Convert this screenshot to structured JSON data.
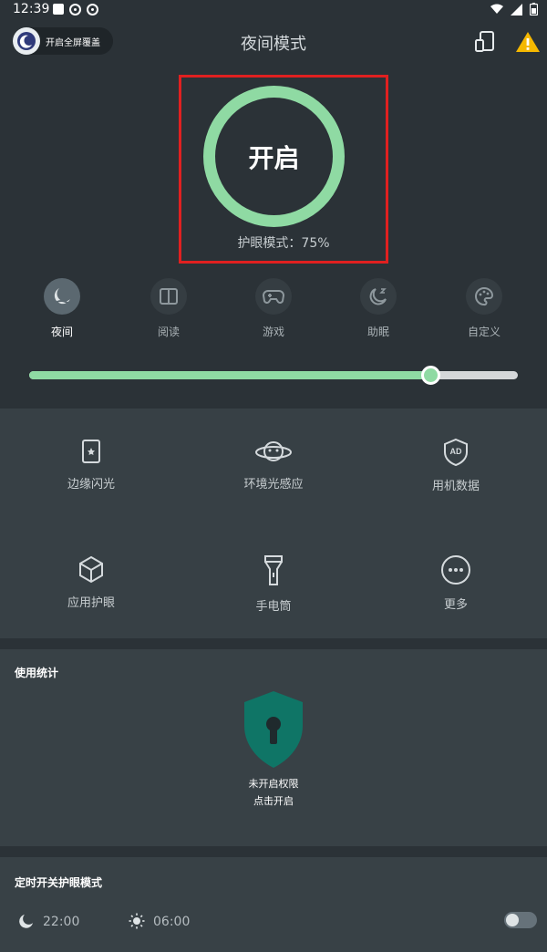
{
  "status_bar": {
    "time": "12:39"
  },
  "header": {
    "overlay_label": "开启全屏覆盖",
    "title": "夜间模式"
  },
  "toggle": {
    "label": "开启",
    "mode_status": "护眼模式：75%",
    "accent": "#8fdaa3"
  },
  "modes": [
    {
      "label": "夜间",
      "icon": "night-icon",
      "active": true
    },
    {
      "label": "阅读",
      "icon": "book-icon",
      "active": false
    },
    {
      "label": "游戏",
      "icon": "gamepad-icon",
      "active": false
    },
    {
      "label": "助眠",
      "icon": "sleep-moon-icon",
      "active": false
    },
    {
      "label": "自定义",
      "icon": "palette-icon",
      "active": false
    }
  ],
  "filter_level_percent": 82,
  "tools": [
    {
      "label": "边缘闪光",
      "icon": "edge-flash-icon"
    },
    {
      "label": "环境光感应",
      "icon": "ambient-light-icon"
    },
    {
      "label": "用机数据",
      "icon": "ad-shield-icon"
    },
    {
      "label": "应用护眼",
      "icon": "cube-icon"
    },
    {
      "label": "手电筒",
      "icon": "flashlight-icon"
    },
    {
      "label": "更多",
      "icon": "more-icon"
    }
  ],
  "usage": {
    "title": "使用统计",
    "permission_line1": "未开启权限",
    "permission_line2": "点击开启"
  },
  "schedule": {
    "title": "定时开关护眼模式",
    "start_time": "22:00",
    "end_time": "06:00",
    "enabled": false
  },
  "colors": {
    "background": "#2b3237",
    "panel": "#374045",
    "warning": "#f5b800",
    "shield": "#0f7566"
  }
}
